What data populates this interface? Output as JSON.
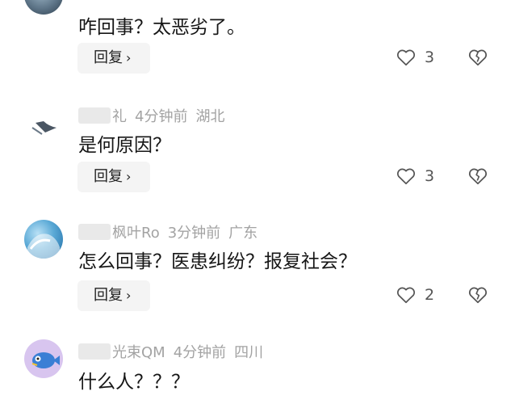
{
  "comments": [
    {
      "user": "",
      "time": "",
      "location": "",
      "text": "咋回事？太恶劣了。",
      "reply_label": "回复",
      "like_count": "3"
    },
    {
      "user": "礼",
      "time": "4分钟前",
      "location": "湖北",
      "text": "是何原因？",
      "reply_label": "回复",
      "like_count": "3"
    },
    {
      "user": "枫叶Ro",
      "time": "3分钟前",
      "location": "广东",
      "text": "怎么回事？医患纠纷？报复社会？",
      "reply_label": "回复",
      "like_count": "2"
    },
    {
      "user": "光束QM",
      "time": "4分钟前",
      "location": "四川",
      "text": "什么人？？？",
      "reply_label": "",
      "like_count": ""
    }
  ],
  "icons": {
    "reply_chevron": "›",
    "like": "heart-outline-icon",
    "dislike": "broken-heart-icon"
  },
  "colors": {
    "text": "#161616",
    "meta": "#a3a3a3",
    "reply_bg": "#f4f4f4"
  }
}
